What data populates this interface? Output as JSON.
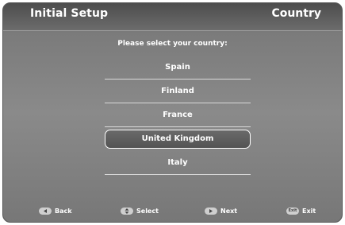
{
  "header": {
    "title": "Initial Setup",
    "section": "Country"
  },
  "prompt": "Please select your country:",
  "countries": [
    {
      "label": "Spain",
      "selected": false
    },
    {
      "label": "Finland",
      "selected": false
    },
    {
      "label": "France",
      "selected": false
    },
    {
      "label": "United Kingdom",
      "selected": true
    },
    {
      "label": "Italy",
      "selected": false
    }
  ],
  "footer": {
    "back_label": "Back",
    "select_label": "Select",
    "next_label": "Next",
    "exit_label": "Exit",
    "exit_key_text": "Exit"
  },
  "icons": {
    "back": "left-arrow-key-icon",
    "select": "up-down-key-icon",
    "next": "right-arrow-key-icon",
    "exit": "exit-key-icon"
  }
}
